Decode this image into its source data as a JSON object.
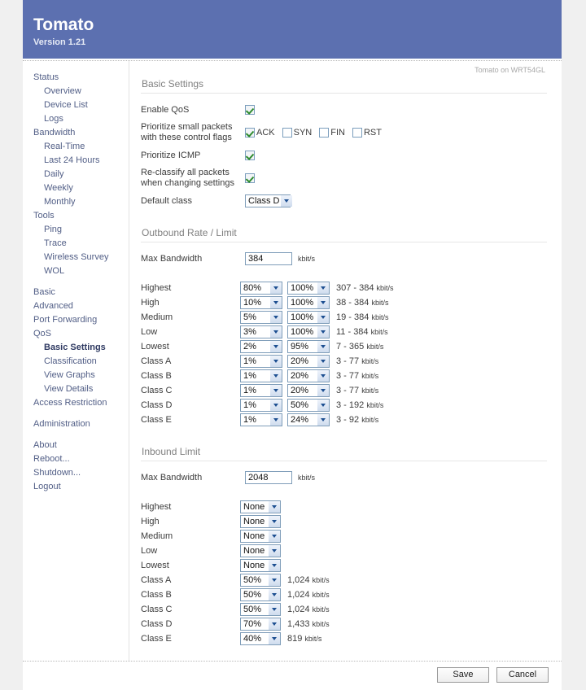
{
  "banner": {
    "title": "Tomato",
    "version": "Version 1.21"
  },
  "device_label": "Tomato on WRT54GL",
  "sidebar": {
    "groups": [
      {
        "top": "Status",
        "items": [
          "Overview",
          "Device List",
          "Logs"
        ]
      },
      {
        "top": "Bandwidth",
        "items": [
          "Real-Time",
          "Last 24 Hours",
          "Daily",
          "Weekly",
          "Monthly"
        ]
      },
      {
        "top": "Tools",
        "items": [
          "Ping",
          "Trace",
          "Wireless Survey",
          "WOL"
        ]
      }
    ],
    "standalone": [
      "Basic",
      "Advanced",
      "Port Forwarding"
    ],
    "qos": {
      "top": "QoS",
      "items": [
        "Basic Settings",
        "Classification",
        "View Graphs",
        "View Details"
      ],
      "active": "Basic Settings"
    },
    "after_qos": [
      "Access Restriction"
    ],
    "admin": [
      "Administration"
    ],
    "footer_links": [
      "About",
      "Reboot...",
      "Shutdown...",
      "Logout"
    ]
  },
  "basic_settings": {
    "title": "Basic Settings",
    "enable_qos": {
      "label": "Enable QoS",
      "checked": true
    },
    "small_packets": {
      "label_line1": "Prioritize small packets",
      "label_line2": "with these control flags",
      "flags": [
        {
          "name": "ACK",
          "checked": true
        },
        {
          "name": "SYN",
          "checked": false
        },
        {
          "name": "FIN",
          "checked": false
        },
        {
          "name": "RST",
          "checked": false
        }
      ]
    },
    "prioritize_icmp": {
      "label": "Prioritize ICMP",
      "checked": true
    },
    "reclassify": {
      "label_line1": "Re-classify all packets",
      "label_line2": "when changing settings",
      "checked": true
    },
    "default_class": {
      "label": "Default class",
      "value": "Class D"
    }
  },
  "outbound": {
    "title": "Outbound Rate / Limit",
    "max_bandwidth": {
      "label": "Max Bandwidth",
      "value": "384",
      "unit": "kbit/s"
    },
    "unit": "kbit/s",
    "rows": [
      {
        "label": "Highest",
        "rate": "80%",
        "limit": "100%",
        "range": "307 - 384",
        "unit": "kbit/s"
      },
      {
        "label": "High",
        "rate": "10%",
        "limit": "100%",
        "range": "38 - 384",
        "unit": "kbit/s"
      },
      {
        "label": "Medium",
        "rate": "5%",
        "limit": "100%",
        "range": "19 - 384",
        "unit": "kbit/s"
      },
      {
        "label": "Low",
        "rate": "3%",
        "limit": "100%",
        "range": "11 - 384",
        "unit": "kbit/s"
      },
      {
        "label": "Lowest",
        "rate": "2%",
        "limit": "95%",
        "range": "7 - 365",
        "unit": "kbit/s"
      },
      {
        "label": "Class A",
        "rate": "1%",
        "limit": "20%",
        "range": "3 - 77",
        "unit": "kbit/s"
      },
      {
        "label": "Class B",
        "rate": "1%",
        "limit": "20%",
        "range": "3 - 77",
        "unit": "kbit/s"
      },
      {
        "label": "Class C",
        "rate": "1%",
        "limit": "20%",
        "range": "3 - 77",
        "unit": "kbit/s"
      },
      {
        "label": "Class D",
        "rate": "1%",
        "limit": "50%",
        "range": "3 - 192",
        "unit": "kbit/s"
      },
      {
        "label": "Class E",
        "rate": "1%",
        "limit": "24%",
        "range": "3 - 92",
        "unit": "kbit/s"
      }
    ]
  },
  "inbound": {
    "title": "Inbound Limit",
    "max_bandwidth": {
      "label": "Max Bandwidth",
      "value": "2048",
      "unit": "kbit/s"
    },
    "rows": [
      {
        "label": "Highest",
        "limit": "None",
        "range": "",
        "unit": ""
      },
      {
        "label": "High",
        "limit": "None",
        "range": "",
        "unit": ""
      },
      {
        "label": "Medium",
        "limit": "None",
        "range": "",
        "unit": ""
      },
      {
        "label": "Low",
        "limit": "None",
        "range": "",
        "unit": ""
      },
      {
        "label": "Lowest",
        "limit": "None",
        "range": "",
        "unit": ""
      },
      {
        "label": "Class A",
        "limit": "50%",
        "range": "1,024",
        "unit": "kbit/s"
      },
      {
        "label": "Class B",
        "limit": "50%",
        "range": "1,024",
        "unit": "kbit/s"
      },
      {
        "label": "Class C",
        "limit": "50%",
        "range": "1,024",
        "unit": "kbit/s"
      },
      {
        "label": "Class D",
        "limit": "70%",
        "range": "1,433",
        "unit": "kbit/s"
      },
      {
        "label": "Class E",
        "limit": "40%",
        "range": "819",
        "unit": "kbit/s"
      }
    ]
  },
  "footer": {
    "save_label": "Save",
    "cancel_label": "Cancel"
  },
  "colors": {
    "banner": "#5c70b0",
    "page_bg": "#f0f0f0",
    "nav_link": "#515e86",
    "section_title": "#808080"
  }
}
